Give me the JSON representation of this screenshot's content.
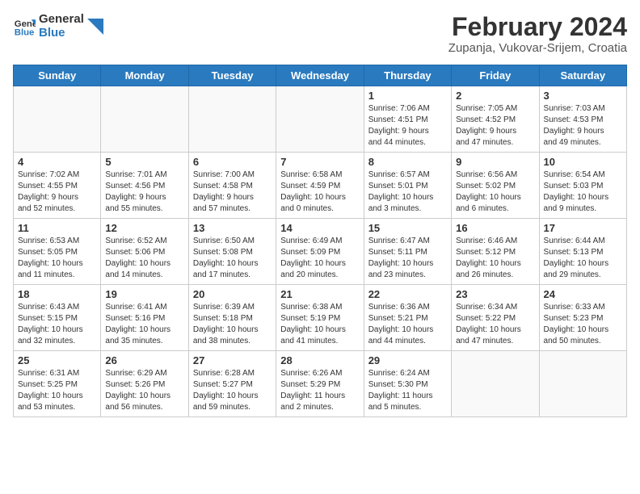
{
  "header": {
    "logo_line1": "General",
    "logo_line2": "Blue",
    "title": "February 2024",
    "subtitle": "Zupanja, Vukovar-Srijem, Croatia"
  },
  "weekdays": [
    "Sunday",
    "Monday",
    "Tuesday",
    "Wednesday",
    "Thursday",
    "Friday",
    "Saturday"
  ],
  "weeks": [
    [
      {
        "day": "",
        "info": ""
      },
      {
        "day": "",
        "info": ""
      },
      {
        "day": "",
        "info": ""
      },
      {
        "day": "",
        "info": ""
      },
      {
        "day": "1",
        "info": "Sunrise: 7:06 AM\nSunset: 4:51 PM\nDaylight: 9 hours\nand 44 minutes."
      },
      {
        "day": "2",
        "info": "Sunrise: 7:05 AM\nSunset: 4:52 PM\nDaylight: 9 hours\nand 47 minutes."
      },
      {
        "day": "3",
        "info": "Sunrise: 7:03 AM\nSunset: 4:53 PM\nDaylight: 9 hours\nand 49 minutes."
      }
    ],
    [
      {
        "day": "4",
        "info": "Sunrise: 7:02 AM\nSunset: 4:55 PM\nDaylight: 9 hours\nand 52 minutes."
      },
      {
        "day": "5",
        "info": "Sunrise: 7:01 AM\nSunset: 4:56 PM\nDaylight: 9 hours\nand 55 minutes."
      },
      {
        "day": "6",
        "info": "Sunrise: 7:00 AM\nSunset: 4:58 PM\nDaylight: 9 hours\nand 57 minutes."
      },
      {
        "day": "7",
        "info": "Sunrise: 6:58 AM\nSunset: 4:59 PM\nDaylight: 10 hours\nand 0 minutes."
      },
      {
        "day": "8",
        "info": "Sunrise: 6:57 AM\nSunset: 5:01 PM\nDaylight: 10 hours\nand 3 minutes."
      },
      {
        "day": "9",
        "info": "Sunrise: 6:56 AM\nSunset: 5:02 PM\nDaylight: 10 hours\nand 6 minutes."
      },
      {
        "day": "10",
        "info": "Sunrise: 6:54 AM\nSunset: 5:03 PM\nDaylight: 10 hours\nand 9 minutes."
      }
    ],
    [
      {
        "day": "11",
        "info": "Sunrise: 6:53 AM\nSunset: 5:05 PM\nDaylight: 10 hours\nand 11 minutes."
      },
      {
        "day": "12",
        "info": "Sunrise: 6:52 AM\nSunset: 5:06 PM\nDaylight: 10 hours\nand 14 minutes."
      },
      {
        "day": "13",
        "info": "Sunrise: 6:50 AM\nSunset: 5:08 PM\nDaylight: 10 hours\nand 17 minutes."
      },
      {
        "day": "14",
        "info": "Sunrise: 6:49 AM\nSunset: 5:09 PM\nDaylight: 10 hours\nand 20 minutes."
      },
      {
        "day": "15",
        "info": "Sunrise: 6:47 AM\nSunset: 5:11 PM\nDaylight: 10 hours\nand 23 minutes."
      },
      {
        "day": "16",
        "info": "Sunrise: 6:46 AM\nSunset: 5:12 PM\nDaylight: 10 hours\nand 26 minutes."
      },
      {
        "day": "17",
        "info": "Sunrise: 6:44 AM\nSunset: 5:13 PM\nDaylight: 10 hours\nand 29 minutes."
      }
    ],
    [
      {
        "day": "18",
        "info": "Sunrise: 6:43 AM\nSunset: 5:15 PM\nDaylight: 10 hours\nand 32 minutes."
      },
      {
        "day": "19",
        "info": "Sunrise: 6:41 AM\nSunset: 5:16 PM\nDaylight: 10 hours\nand 35 minutes."
      },
      {
        "day": "20",
        "info": "Sunrise: 6:39 AM\nSunset: 5:18 PM\nDaylight: 10 hours\nand 38 minutes."
      },
      {
        "day": "21",
        "info": "Sunrise: 6:38 AM\nSunset: 5:19 PM\nDaylight: 10 hours\nand 41 minutes."
      },
      {
        "day": "22",
        "info": "Sunrise: 6:36 AM\nSunset: 5:21 PM\nDaylight: 10 hours\nand 44 minutes."
      },
      {
        "day": "23",
        "info": "Sunrise: 6:34 AM\nSunset: 5:22 PM\nDaylight: 10 hours\nand 47 minutes."
      },
      {
        "day": "24",
        "info": "Sunrise: 6:33 AM\nSunset: 5:23 PM\nDaylight: 10 hours\nand 50 minutes."
      }
    ],
    [
      {
        "day": "25",
        "info": "Sunrise: 6:31 AM\nSunset: 5:25 PM\nDaylight: 10 hours\nand 53 minutes."
      },
      {
        "day": "26",
        "info": "Sunrise: 6:29 AM\nSunset: 5:26 PM\nDaylight: 10 hours\nand 56 minutes."
      },
      {
        "day": "27",
        "info": "Sunrise: 6:28 AM\nSunset: 5:27 PM\nDaylight: 10 hours\nand 59 minutes."
      },
      {
        "day": "28",
        "info": "Sunrise: 6:26 AM\nSunset: 5:29 PM\nDaylight: 11 hours\nand 2 minutes."
      },
      {
        "day": "29",
        "info": "Sunrise: 6:24 AM\nSunset: 5:30 PM\nDaylight: 11 hours\nand 5 minutes."
      },
      {
        "day": "",
        "info": ""
      },
      {
        "day": "",
        "info": ""
      }
    ]
  ]
}
